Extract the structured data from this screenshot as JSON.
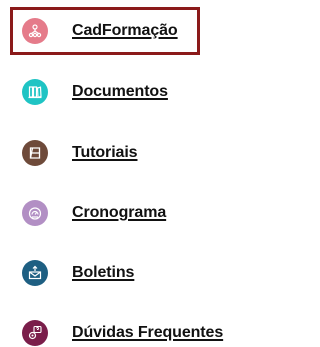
{
  "nav": {
    "active_index": 0,
    "active_border_color": "#8b1a1a",
    "items": [
      {
        "label": "CadFormação",
        "icon": "people-network-icon",
        "color": "#e57b8a"
      },
      {
        "label": "Documentos",
        "icon": "documents-icon",
        "color": "#1fc4c4"
      },
      {
        "label": "Tutoriais",
        "icon": "tutorial-icon",
        "color": "#6e4a3a"
      },
      {
        "label": "Cronograma",
        "icon": "gauge-icon",
        "color": "#b28fc4"
      },
      {
        "label": "Boletins",
        "icon": "envelope-upload-icon",
        "color": "#1e5f82"
      },
      {
        "label": "Dúvidas Frequentes",
        "icon": "question-gear-icon",
        "color": "#7a1e4a"
      }
    ]
  }
}
